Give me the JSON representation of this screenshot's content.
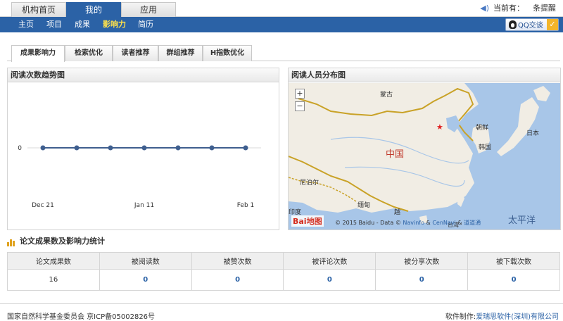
{
  "top_tabs": [
    "机构首页",
    "我的",
    "应用"
  ],
  "notice": {
    "label": "当前有：",
    "value": "条提醒"
  },
  "subnav": [
    "主页",
    "项目",
    "成果",
    "影响力",
    "简历"
  ],
  "qq_button": "QQ交谈",
  "content_tabs": [
    "成果影响力",
    "检索优化",
    "读者推荐",
    "群组推荐",
    "H指数优化"
  ],
  "trend_panel": {
    "title": "阅读次数趋势图"
  },
  "map_panel": {
    "title": "阅读人员分布图",
    "zoom_in": "+",
    "zoom_out": "−",
    "labels": {
      "mongolia": "蒙古",
      "china": "中国",
      "korea_north": "朝鲜",
      "korea_south": "韩国",
      "japan": "日本",
      "nepal": "尼泊尔",
      "myanmar": "缅甸",
      "india": "印度",
      "vietnam": "越",
      "pacific": "太平洋",
      "taiwan": "台湾"
    },
    "baidu_logo": "Bai地图",
    "copyright": "© 2015 Baidu - Data ©",
    "copyright_link1": "Navinfo",
    "copyright_amp": "&",
    "copyright_link2": "CenNavi",
    "copyright_amp2": "&",
    "copyright_link3": "道道通"
  },
  "stats_section": {
    "title": "论文成果数及影响力统计",
    "headers": [
      "论文成果数",
      "被阅读数",
      "被赞次数",
      "被评论次数",
      "被分享次数",
      "被下载次数"
    ],
    "values": [
      "16",
      "0",
      "0",
      "0",
      "0",
      "0"
    ]
  },
  "footer": {
    "left": "国家自然科学基金委员会 京ICP备05002826号",
    "right_label": "软件制作:",
    "right_link": "爱瑞思软件(深圳)有限公司"
  },
  "chart_data": {
    "type": "line",
    "x": [
      "Dec 21",
      "Dec 28",
      "Jan 4",
      "Jan 11",
      "Jan 18",
      "Jan 25",
      "Feb 1"
    ],
    "x_ticks": [
      "Dec 21",
      "Jan 11",
      "Feb 1"
    ],
    "y_ticks": [
      "0"
    ],
    "series": [
      {
        "values": [
          0,
          0,
          0,
          0,
          0,
          0,
          0
        ]
      }
    ],
    "line_color": "#3f5f8f",
    "grid": true
  },
  "colors": {
    "nav_blue": "#2b62a6",
    "active_sub": "#ffe14a",
    "link_blue": "#2b62a6",
    "land": "#f1ede4",
    "sea": "#a8c6e8",
    "border": "#c9a227",
    "marker": "#e02020"
  }
}
